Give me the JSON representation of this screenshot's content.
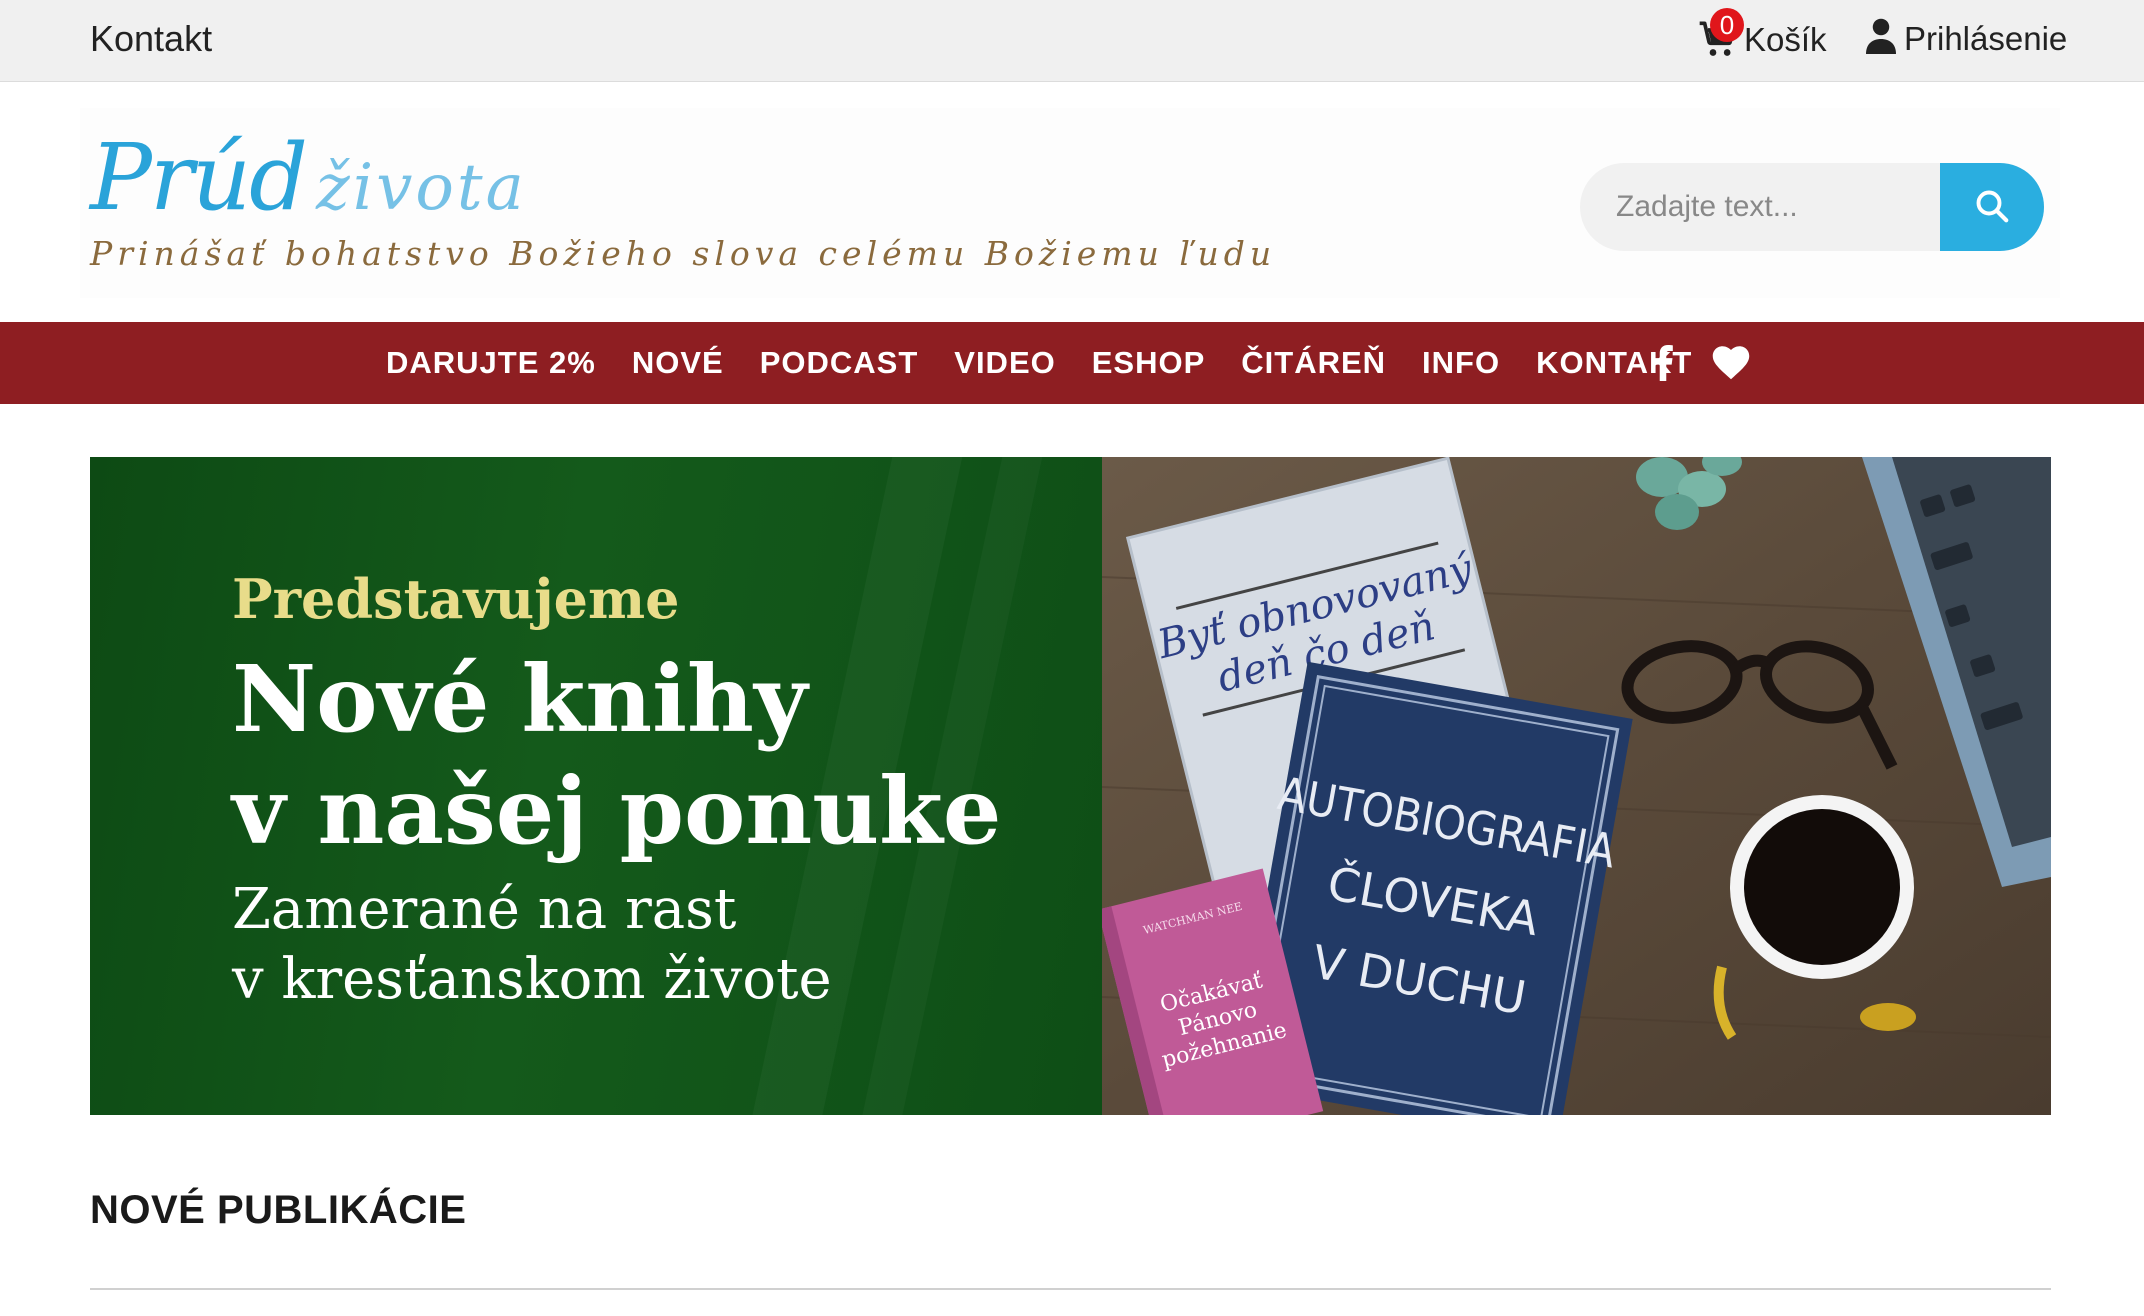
{
  "topbar": {
    "contact_label": "Kontakt",
    "cart_count": "0",
    "cart_label": "Košík",
    "login_label": "Prihlásenie"
  },
  "header": {
    "logo_word1": "Prúd",
    "logo_word2": "života",
    "tagline": "Prinášať bohatstvo Božieho slova celému Božiemu ľudu",
    "search_placeholder": "Zadajte text..."
  },
  "nav": {
    "items": [
      "DARUJTE 2%",
      "NOVÉ",
      "PODCAST",
      "VIDEO",
      "ESHOP",
      "ČITÁREŇ",
      "INFO",
      "KONTAKT"
    ],
    "icons": [
      "facebook-icon",
      "heart-icon"
    ]
  },
  "banner": {
    "kicker": "Predstavujeme",
    "title_line1": "Nové knihy",
    "title_line2": "v našej ponuke",
    "subtitle_line1": "Zamerané na rast",
    "subtitle_line2": "v kresťanskom živote",
    "book1_title_line1": "Byť obnovovaný",
    "book1_title_line2": "deň čo deň",
    "book2_title_line1": "AUTOBIOGRAFIA",
    "book2_title_line2": "ČLOVEKA",
    "book2_title_line3": "V DUCHU",
    "book3_author": "WATCHMAN NEE",
    "book3_title_line1": "Očakávať",
    "book3_title_line2": "Pánovo",
    "book3_title_line3": "požehnanie"
  },
  "section": {
    "title": "NOVÉ PUBLIKÁCIE"
  },
  "colors": {
    "nav_bg": "#8e1e22",
    "search_button": "#2aaee0",
    "banner_green": "#145a1b",
    "badge_red": "#e0161b",
    "logo_blue": "#2aa3d9",
    "tagline_brown": "#8a6a3d"
  }
}
